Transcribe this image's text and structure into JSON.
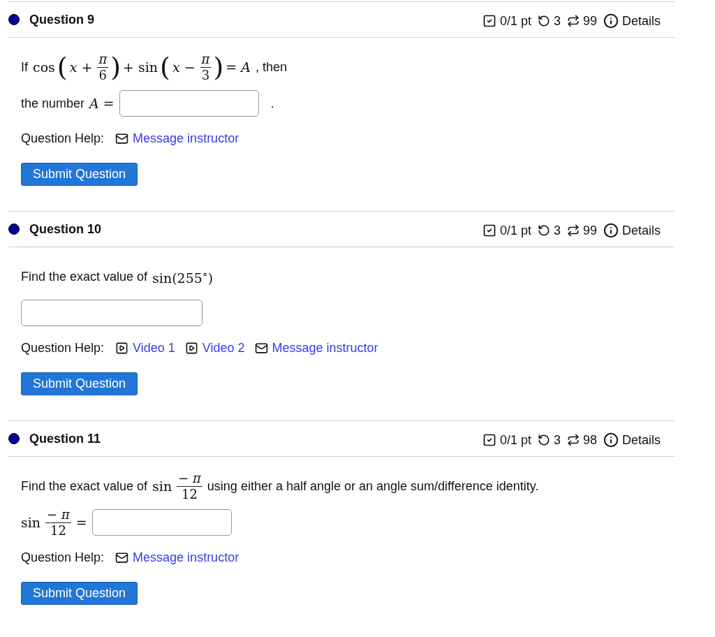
{
  "questions": [
    {
      "title": "Question 9",
      "color": "#00009c",
      "score": "0/1 pt",
      "tries": "3",
      "regens": "99",
      "details": "Details",
      "lines": [
        [
          {
            "kind": "text",
            "text": "If"
          },
          {
            "kind": "math",
            "text": "cos"
          },
          {
            "kind": "paren",
            "text": "("
          },
          {
            "kind": "math",
            "text": "*x* +"
          },
          {
            "kind": "frac",
            "num": "*π*",
            "den": "6"
          },
          {
            "kind": "paren",
            "text": ")"
          },
          {
            "kind": "math",
            "text": "+ sin"
          },
          {
            "kind": "paren",
            "text": "("
          },
          {
            "kind": "math",
            "text": "*x* −"
          },
          {
            "kind": "frac",
            "num": "*π*",
            "den": "3"
          },
          {
            "kind": "paren",
            "text": ")"
          },
          {
            "kind": "math",
            "text": "= *A*"
          },
          {
            "kind": "text",
            "text": ", then"
          }
        ],
        [
          {
            "kind": "text",
            "text": "the number"
          },
          {
            "kind": "math",
            "text": "*A* ="
          },
          {
            "kind": "field"
          },
          {
            "kind": "text",
            "text": "."
          }
        ]
      ],
      "help_label": "Question Help:",
      "help": [
        {
          "kind": "message",
          "label": "Message instructor"
        }
      ],
      "submit": "Submit Question"
    },
    {
      "title": "Question 10",
      "color": "#00009c",
      "score": "0/1 pt",
      "tries": "3",
      "regens": "99",
      "details": "Details",
      "lines": [
        [
          {
            "kind": "text",
            "text": "Find the exact value of"
          },
          {
            "kind": "math",
            "text": "sin(255$^{∘}$)"
          }
        ],
        [
          {
            "kind": "field"
          }
        ]
      ],
      "help_label": "Question Help:",
      "help": [
        {
          "kind": "video",
          "label": "Video 1"
        },
        {
          "kind": "video",
          "label": "Video 2"
        },
        {
          "kind": "message",
          "label": "Message instructor"
        }
      ],
      "submit": "Submit Question"
    },
    {
      "title": "Question 11",
      "color": "#00009c",
      "score": "0/1 pt",
      "tries": "3",
      "regens": "98",
      "details": "Details",
      "lines": [
        [
          {
            "kind": "text",
            "text": "Find the exact value of"
          },
          {
            "kind": "math",
            "text": "sin"
          },
          {
            "kind": "frac",
            "num": "− *π*",
            "den": "12"
          },
          {
            "kind": "text",
            "text": "using either a half angle or an angle sum/difference identity."
          }
        ],
        [
          {
            "kind": "math",
            "text": "sin"
          },
          {
            "kind": "frac",
            "num": "− *π*",
            "den": "12"
          },
          {
            "kind": "math",
            "text": "="
          },
          {
            "kind": "field"
          }
        ]
      ],
      "help_label": "Question Help:",
      "help": [
        {
          "kind": "message",
          "label": "Message instructor"
        }
      ],
      "submit": "Submit Question"
    }
  ]
}
